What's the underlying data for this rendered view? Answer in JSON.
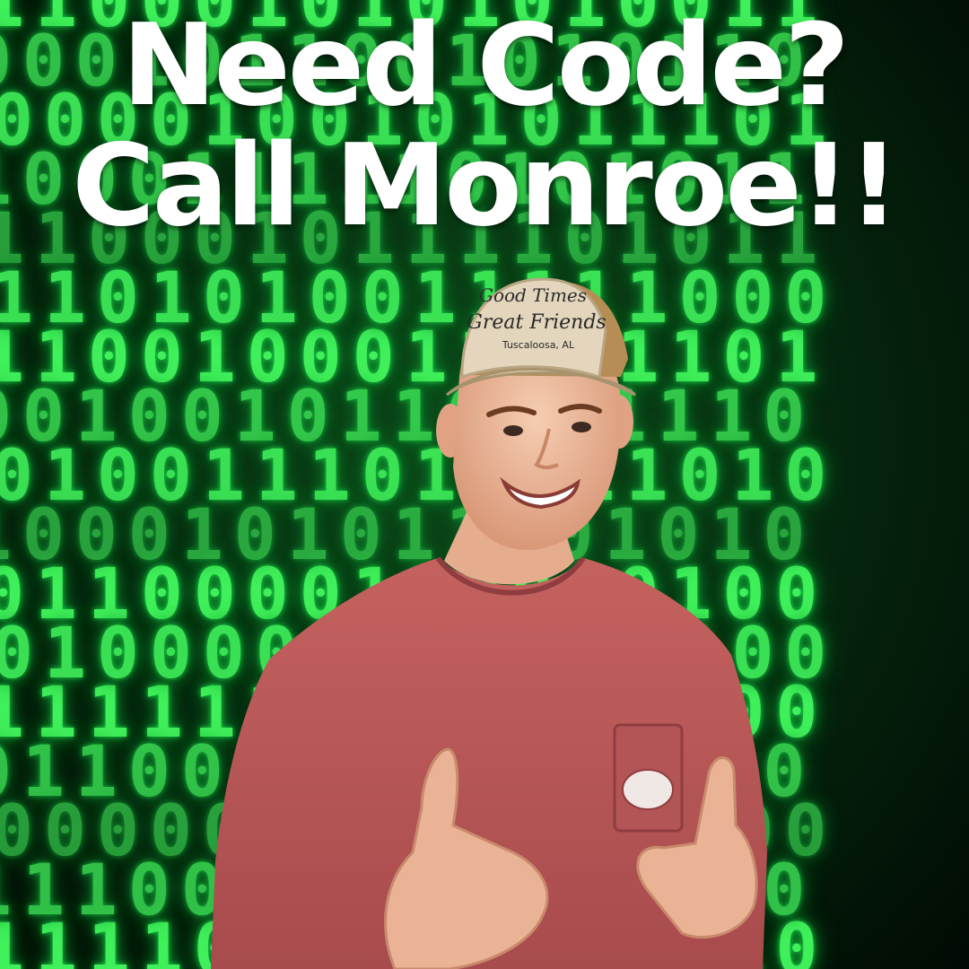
{
  "headline": {
    "line1": "Need Code?",
    "line2": "Call Monroe!!"
  },
  "background": {
    "binary_rows": [
      "1100010101010011",
      "0001011001010110",
      "0000100101011101",
      "1000111110101011",
      "1100010111101011",
      "1101010011111000",
      "1100100011101101",
      "0010010110111110",
      "0100111010111010",
      "1000101011101010",
      "0110000110010100",
      "0100001111001100",
      "1111110000110000",
      "0110011010100100",
      "0000011110011000",
      "1110001011010010",
      "1111001100111010"
    ]
  },
  "photo": {
    "hat_text_line1": "Good Times",
    "hat_text_line2": "Great Friends",
    "hat_text_line3": "Tuscaloosa, AL"
  },
  "colors": {
    "matrix_green": "#3ff05a",
    "background_dark": "#062a10",
    "shirt": "#b9585a",
    "hat_front": "#e4d6bc",
    "hat_mesh": "#b58d55",
    "skin": "#efc0a4",
    "headline": "#ffffff"
  }
}
